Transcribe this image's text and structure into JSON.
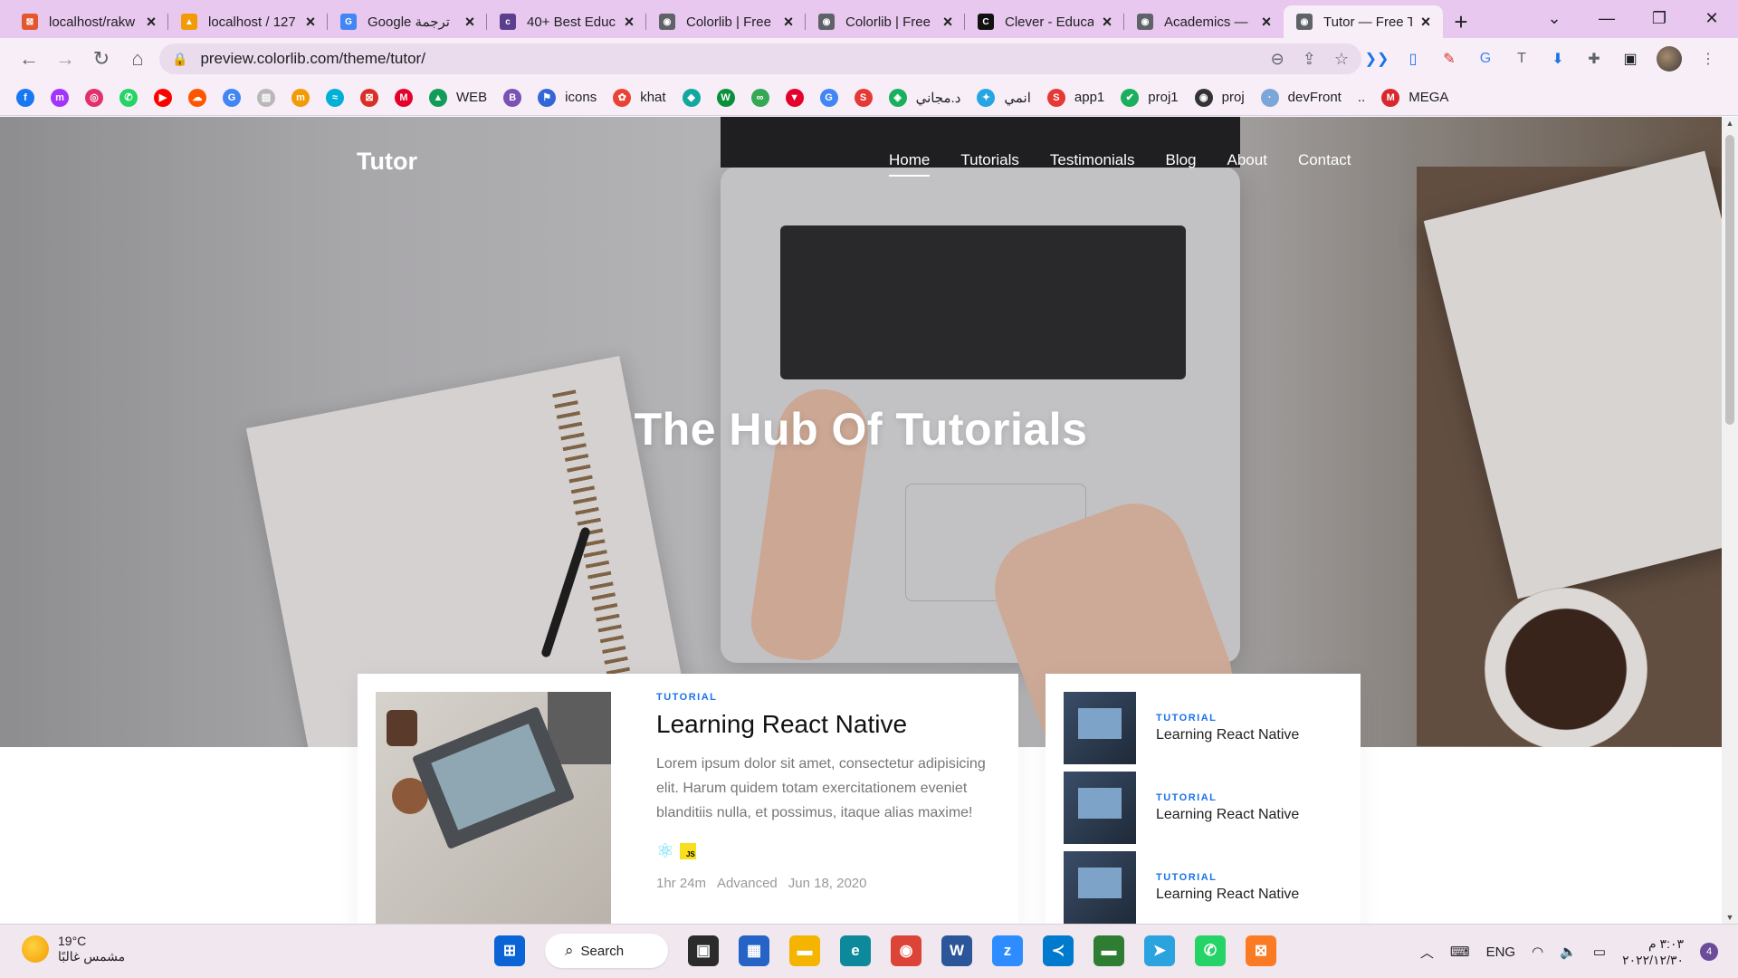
{
  "browser": {
    "tabs": [
      {
        "title": "localhost/rakw",
        "fav_color": "#e4572e",
        "fav_glyph": "⊠"
      },
      {
        "title": "localhost / 127",
        "fav_color": "#f29b05",
        "fav_glyph": "▲"
      },
      {
        "title": "Google ترجمة",
        "fav_color": "#4285f4",
        "fav_glyph": "G"
      },
      {
        "title": "40+ Best Educ",
        "fav_color": "#5b3f8c",
        "fav_glyph": "c"
      },
      {
        "title": "Colorlib | Free",
        "fav_color": "#5f6368",
        "fav_glyph": "◉"
      },
      {
        "title": "Colorlib | Free",
        "fav_color": "#5f6368",
        "fav_glyph": "◉"
      },
      {
        "title": "Clever - Educa",
        "fav_color": "#111111",
        "fav_glyph": "C"
      },
      {
        "title": "Academics —",
        "fav_color": "#5f6368",
        "fav_glyph": "◉"
      },
      {
        "title": "Tutor — Free T",
        "fav_color": "#5f6368",
        "fav_glyph": "◉"
      }
    ],
    "active_tab_index": 8,
    "url": "preview.colorlib.com/theme/tutor/"
  },
  "bookmarks": [
    {
      "label": "",
      "color": "#1877f2",
      "glyph": "f"
    },
    {
      "label": "",
      "color": "#a334fa",
      "glyph": "m"
    },
    {
      "label": "",
      "color": "#e1306c",
      "glyph": "◎"
    },
    {
      "label": "",
      "color": "#25d366",
      "glyph": "✆"
    },
    {
      "label": "",
      "color": "#ff0000",
      "glyph": "▶"
    },
    {
      "label": "",
      "color": "#ff5500",
      "glyph": "☁"
    },
    {
      "label": "",
      "color": "#4285f4",
      "glyph": "G"
    },
    {
      "label": "",
      "color": "#b8b8b8",
      "glyph": "▤"
    },
    {
      "label": "",
      "color": "#f29b05",
      "glyph": "m"
    },
    {
      "label": "",
      "color": "#00b0d7",
      "glyph": "≈"
    },
    {
      "label": "",
      "color": "#d93025",
      "glyph": "⊠"
    },
    {
      "label": "",
      "color": "#e4002b",
      "glyph": "M"
    },
    {
      "label": "WEB",
      "color": "#0f9d58",
      "glyph": "▲"
    },
    {
      "label": "",
      "color": "#7952b3",
      "glyph": "B"
    },
    {
      "label": "icons",
      "color": "#3367d6",
      "glyph": "⚑"
    },
    {
      "label": "khat",
      "color": "#ea4335",
      "glyph": "✿"
    },
    {
      "label": "",
      "color": "#13a89e",
      "glyph": "◆"
    },
    {
      "label": "",
      "color": "#0a8f3c",
      "glyph": "W"
    },
    {
      "label": "",
      "color": "#34a853",
      "glyph": "∞"
    },
    {
      "label": "",
      "color": "#e4002b",
      "glyph": "▼"
    },
    {
      "label": "",
      "color": "#4285f4",
      "glyph": "G"
    },
    {
      "label": "",
      "color": "#e53935",
      "glyph": "S"
    },
    {
      "label": "د.مجاني",
      "color": "#1aaf5d",
      "glyph": "◈"
    },
    {
      "label": "انمي",
      "color": "#26a5e4",
      "glyph": "✦"
    },
    {
      "label": "app1",
      "color": "#e53935",
      "glyph": "S"
    },
    {
      "label": "proj1",
      "color": "#1aaf5d",
      "glyph": "✔"
    },
    {
      "label": "proj",
      "color": "#333333",
      "glyph": "◉"
    },
    {
      "label": "devFront",
      "color": "#7aa7d8",
      "glyph": "·"
    },
    {
      "label": "..",
      "color": "transparent",
      "glyph": ""
    },
    {
      "label": "MEGA",
      "color": "#d9272e",
      "glyph": "M"
    }
  ],
  "site": {
    "brand": "Tutor",
    "nav": [
      "Home",
      "Tutorials",
      "Testimonials",
      "Blog",
      "About",
      "Contact"
    ],
    "nav_active_index": 0,
    "hero": {
      "pre": "The ",
      "bold1": "Hub",
      "mid": " Of ",
      "bold2": "Tutorials"
    },
    "main_card": {
      "tag": "Tutorial",
      "title": "Learning React Native",
      "excerpt": "Lorem ipsum dolor sit amet, consectetur adipisicing elit. Harum quidem totam exercitationem eveniet blanditiis nulla, et possimus, itaque alias maxime!",
      "duration": "1hr 24m",
      "level": "Advanced",
      "date": "Jun 18, 2020",
      "js_badge": "JS"
    },
    "side_items": [
      {
        "tag": "Tutorial",
        "title": "Learning React Native"
      },
      {
        "tag": "Tutorial",
        "title": "Learning React Native"
      },
      {
        "tag": "Tutorial",
        "title": "Learning React Native"
      }
    ]
  },
  "taskbar": {
    "weather_temp": "19°C",
    "weather_desc": "مشمس غالبًا",
    "search_label": "Search",
    "apps": [
      {
        "name": "start",
        "color": "#0a64d6",
        "glyph": "⊞"
      },
      {
        "name": "task-view",
        "color": "#2b2b2b",
        "glyph": "▣"
      },
      {
        "name": "store",
        "color": "#2563c7",
        "glyph": "▦"
      },
      {
        "name": "explorer",
        "color": "#f4b400",
        "glyph": "▬"
      },
      {
        "name": "edge",
        "color": "#0c8a9b",
        "glyph": "e"
      },
      {
        "name": "chrome",
        "color": "#db4437",
        "glyph": "◉"
      },
      {
        "name": "word",
        "color": "#2b579a",
        "glyph": "W"
      },
      {
        "name": "zoom",
        "color": "#2d8cff",
        "glyph": "z"
      },
      {
        "name": "vscode",
        "color": "#007acc",
        "glyph": "≺"
      },
      {
        "name": "terminal",
        "color": "#2e7d32",
        "glyph": "▬"
      },
      {
        "name": "telegram",
        "color": "#2aa3df",
        "glyph": "➤"
      },
      {
        "name": "whatsapp",
        "color": "#25d366",
        "glyph": "✆"
      },
      {
        "name": "xampp",
        "color": "#fb7a24",
        "glyph": "⊠"
      }
    ],
    "lang": "ENG",
    "time": "٣:٠٣ م",
    "date": "٢٠٢٢/١٢/٣٠",
    "notifications": "4"
  }
}
